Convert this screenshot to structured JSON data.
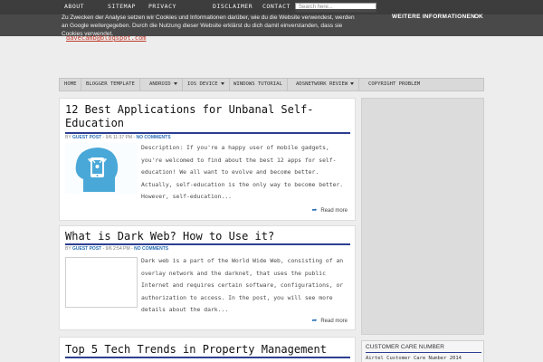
{
  "topnav": {
    "items": [
      "ABOUT",
      "SITEMAP",
      "PRIVACY",
      "DISCLAIMER",
      "CONTACT"
    ],
    "search_placeholder": "Search here..."
  },
  "cookie": {
    "text": "Zu Zwecken der Analyse setzen wir Cookies und Informationen darüber, wie du die Website verwendest, werden an Google weitergegeben. Durch die Nutzung dieser Website erklärst du dich damit einverstanden, dass sie Cookies verwendet.",
    "more_info": "WEITERE INFORMATIONEN",
    "ok": "OK"
  },
  "email": "davecamb@blogspot.com",
  "menu": [
    "HOME",
    "BLOGGER TEMPLATE",
    "ANDROID",
    "IOS DEVICE",
    "WINDOWS TUTORIAL",
    "ADSNETWORK REVIEW",
    "COPYRIGHT PROBLEM"
  ],
  "posts": [
    {
      "title_line1": "12 Best Applications for Unbanal Self-",
      "title_line2": "Education",
      "by": "BY",
      "author": "GUEST POST",
      "date": "- 9/6 11:37 PM -",
      "comments": "NO COMMENTS",
      "excerpt": "Description: If you're a happy user of mobile gadgets, you're welcomed to find about the best 12 apps for self-education! We all want to evolve and become better. Actually, self-education is the only way to become better. However, self-education...",
      "read_more": "Read more"
    },
    {
      "title": "What is Dark Web? How to Use it?",
      "by": "BY",
      "author": "GUEST POST",
      "date": "- 9/6 2:54 PM -",
      "comments": "NO COMMENTS",
      "excerpt": "Dark web is a part of the World Wide Web, consisting of an overlay network and the darknet, that uses the public Internet and requires certain software, configurations, or authorization to access. In the post, you will see more details about the dark...",
      "read_more": "Read more"
    },
    {
      "title": "Top 5 Tech Trends in Property Management"
    }
  ],
  "sidebar": {
    "widget_title": "CUSTOMER CARE NUMBER",
    "widget_link": "Airtel Customer Care Number 2014"
  },
  "colors": {
    "topnav": "#3d3d3d",
    "accent": "#2c3e91",
    "link": "#2b6fb6",
    "thumb": "#4aa8d8"
  }
}
